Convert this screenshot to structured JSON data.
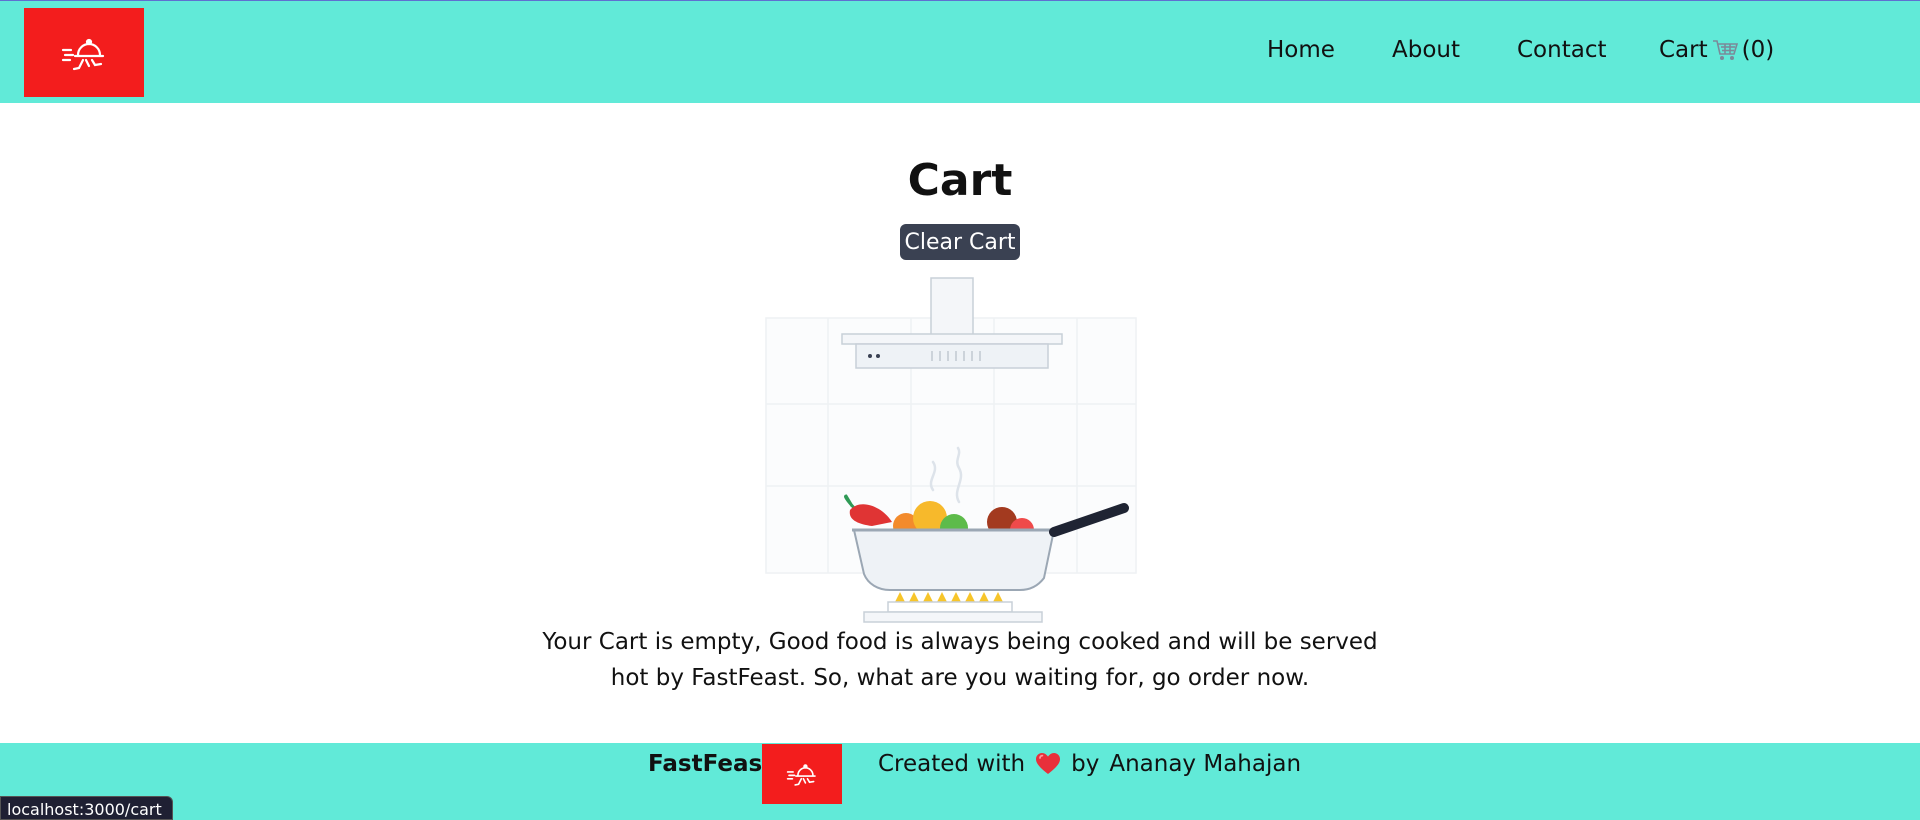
{
  "header": {
    "logo_icon": "delivery-runner-cloche-icon",
    "nav": {
      "home": "Home",
      "about": "About",
      "contact": "Contact",
      "cart": "Cart",
      "cart_icon": "shopping-cart-icon",
      "cart_count": "(0)"
    }
  },
  "main": {
    "title": "Cart",
    "clear_button": "Clear Cart",
    "illustration": "cooking-pan-on-stove-illustration",
    "empty_message": "Your Cart is empty, Good food is always being cooked and will be served hot by FastFeast. So, what are you waiting for, go order now."
  },
  "footer": {
    "brand": "FastFeast",
    "created_with": "Created with",
    "heart_icon": "heart-icon",
    "by": "by",
    "author": "Ananay Mahajan"
  },
  "status_bar": {
    "url": "localhost:3000/cart"
  },
  "colors": {
    "header_bg": "#61ead8",
    "logo_bg": "#f31d1d",
    "button_bg": "#3a4152"
  }
}
